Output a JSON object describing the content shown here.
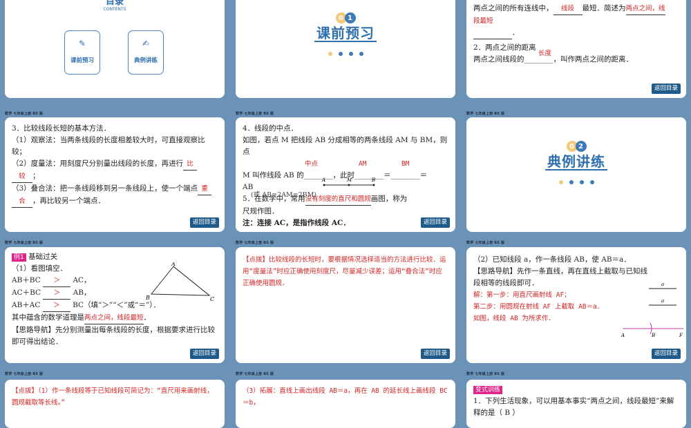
{
  "header_text": "数学 七年级上册 BS 版",
  "back_label": "返回目录",
  "toc": {
    "title": "目录",
    "subtitle": "CONTENTS",
    "btn1": "课前预习",
    "btn2": "典例讲练"
  },
  "sec1": {
    "num1": "0",
    "num2": "1",
    "title": "课前预习"
  },
  "sec2": {
    "num1": "0",
    "num2": "2",
    "title": "典例讲练"
  },
  "t3": {
    "line1a": "两点之间的所有连线中，",
    "ans1": "线段",
    "line1b": "最短．简述为",
    "ans2": "两点之间，线",
    "ans2b": "段最短",
    "line2": "2．两点之间的距离",
    "ans3": "长度",
    "line3": "两点之间线段的________，叫作两点之间的距离．"
  },
  "t4": {
    "l1": "3．比较线段长短的基本方法．",
    "l2": "（1）观察法：当两条线段的长度相差较大时，可直接观察比较；",
    "l3a": "（2）度量法：用刻度尺分别量出线段的长度，再进行",
    "a1": "比",
    "a1b": "较",
    "l4a": "（3）叠合法：把一条线段移到另一条线段上，使一个端点",
    "a2": "重",
    "a2b": "合",
    "l4b": "，再比较另一个端点．"
  },
  "t5": {
    "l1": "4．线段的中点．",
    "l2": "如图，若点 M 把线段 AB 分成相等的两条线段 AM 与 BM，则点",
    "a1": "中点",
    "a2": "AM",
    "a3": "BM",
    "l3": "M 叫作线段 AB 的________，此时________＝________＝",
    "l4": "AB",
    "l5a": "5．在数学中，常用",
    "a4": "没有刻度的直尺和圆规",
    "l5b": "画图，称为",
    "l6": "尺规作图．",
    "l7": "注：连接 AC，是指作线段 AC．",
    "pts": [
      "A",
      "M",
      "B"
    ],
    "extra": "(或 AB=2AM=2BM)"
  },
  "t7": {
    "tag": "例1",
    "tagt": "基础过关",
    "l1": "（1）看图填空．",
    "r1a": "AB＋BC",
    "r1b": "AC，",
    "r2a": "AC＋BC",
    "r2b": "AB，",
    "r3a": "AB＋AC",
    "r3b": "BC（填“＞”“＜”或“＝”）．",
    "ans": "＞",
    "l5a": "其中蕴含的数学道理是",
    "a5": "两点之间，线段最短",
    "l6": "【思路导航】先分别测量出每条线段的长度，根据要求进行比较即可得出结论．",
    "pts": [
      "A",
      "B",
      "C"
    ]
  },
  "t8": {
    "text": "【点拨】比较线段的长短时，要根据情况选择适当的方法进行比较．运用“度量法”时应正确使用刻度尺，尽量减少误差；运用“叠合法”时应正确使用圆规．"
  },
  "t9": {
    "l1": "（2）已知线段 a，作一条线段 AB，使 AB＝a．",
    "l2": "【思路导航】先作一条直线，再在直线上截取与已知线段相等的线段即可．",
    "s1": "解：第一步：用直尺画射线 AF；",
    "s2": "第二步：用圆规在射线 AF 上截取 AB＝a．",
    "s3": "如图，线段 AB 为所求作．",
    "lbl": [
      "a",
      "a",
      "A",
      "B",
      "F"
    ]
  },
  "t10": {
    "text": "【点拨】（1）作一条线段等于已知线段可简记为：“直尺用来画射线，圆规截取等长线。”"
  },
  "t11": {
    "text": "（3）拓展：直线上画出线段 AB＝a，再在 AB 的延长线上画线段 BC＝b，"
  },
  "t12": {
    "tag": "变式训练",
    "l1": "1．下列生活现象，可以用基本事实“两点之间，线段最短”来解释的是（  B  ）"
  }
}
